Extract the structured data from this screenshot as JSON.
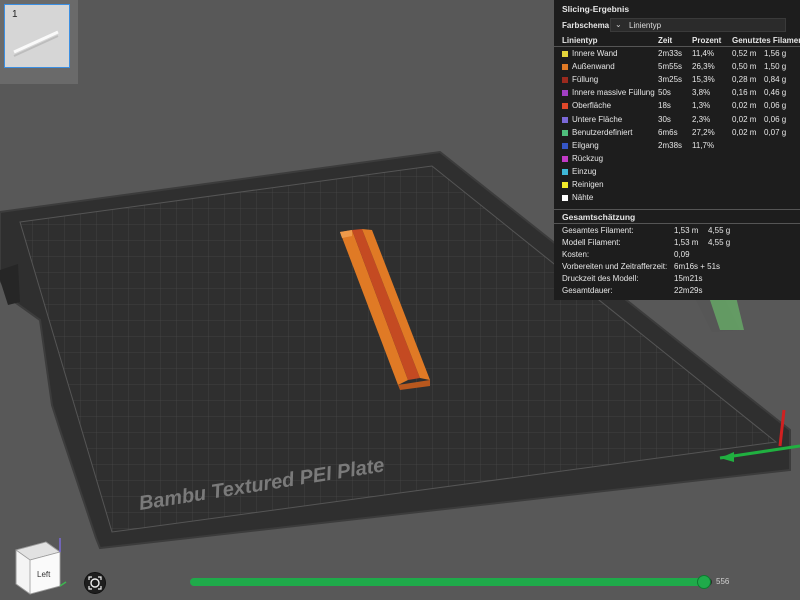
{
  "plate": {
    "label": "Bambu Textured PEI Plate",
    "thumbnail_number": "1"
  },
  "slicing_result": {
    "title": "Slicing-Ergebnis",
    "color_scheme_label": "Farbschema",
    "color_scheme_value": "Linientyp",
    "columns": [
      "Linientyp",
      "Zeit",
      "Prozent",
      "Genutztes Filament"
    ],
    "rows": [
      {
        "type": "Innere Wand",
        "time": "2m33s",
        "percent": "11,4%",
        "length": "0,52 m",
        "weight": "1,56 g",
        "color": "#e3d43b"
      },
      {
        "type": "Außenwand",
        "time": "5m55s",
        "percent": "26,3%",
        "length": "0,50 m",
        "weight": "1,50 g",
        "color": "#e07a25"
      },
      {
        "type": "Füllung",
        "time": "3m25s",
        "percent": "15,3%",
        "length": "0,28 m",
        "weight": "0,84 g",
        "color": "#9b2a1e"
      },
      {
        "type": "Innere massive Füllung",
        "time": "50s",
        "percent": "3,8%",
        "length": "0,16 m",
        "weight": "0,46 g",
        "color": "#a23fc4"
      },
      {
        "type": "Oberfläche",
        "time": "18s",
        "percent": "1,3%",
        "length": "0,02 m",
        "weight": "0,06 g",
        "color": "#e0482a"
      },
      {
        "type": "Untere Fläche",
        "time": "30s",
        "percent": "2,3%",
        "length": "0,02 m",
        "weight": "0,06 g",
        "color": "#7b68d8"
      },
      {
        "type": "Benutzerdefiniert",
        "time": "6m6s",
        "percent": "27,2%",
        "length": "0,02 m",
        "weight": "0,07 g",
        "color": "#4fbf7c"
      },
      {
        "type": "Eilgang",
        "time": "2m38s",
        "percent": "11,7%",
        "length": "",
        "weight": "",
        "color": "#3556c6"
      },
      {
        "type": "Rückzug",
        "time": "",
        "percent": "",
        "length": "",
        "weight": "",
        "color": "#c23ac6"
      },
      {
        "type": "Einzug",
        "time": "",
        "percent": "",
        "length": "",
        "weight": "",
        "color": "#3fb8d8"
      },
      {
        "type": "Reinigen",
        "time": "",
        "percent": "",
        "length": "",
        "weight": "",
        "color": "#f2ea2a"
      },
      {
        "type": "Nähte",
        "time": "",
        "percent": "",
        "length": "",
        "weight": "",
        "color": "#ffffff"
      }
    ],
    "summary_title": "Gesamtschätzung",
    "summary": [
      {
        "label": "Gesamtes Filament:",
        "value1": "1,53 m",
        "value2": "4,55 g"
      },
      {
        "label": "Modell Filament:",
        "value1": "1,53 m",
        "value2": "4,55 g"
      },
      {
        "label": "Kosten:",
        "value1": "0,09",
        "value2": ""
      },
      {
        "label": "Vorbereiten und Zeitrafferzeit:",
        "value1": "6m16s + 51s",
        "value2": ""
      },
      {
        "label": "Druckzeit des Modell:",
        "value1": "15m21s",
        "value2": ""
      },
      {
        "label": "Gesamtdauer:",
        "value1": "22m29s",
        "value2": ""
      }
    ]
  },
  "layer_slider": {
    "value": "556",
    "fill_fraction": 0.98
  },
  "view_cube": {
    "face_label": "Left"
  },
  "colors": {
    "accent": "#1faa4a",
    "plate": "#2f2f2f",
    "model": "#e07a25"
  }
}
